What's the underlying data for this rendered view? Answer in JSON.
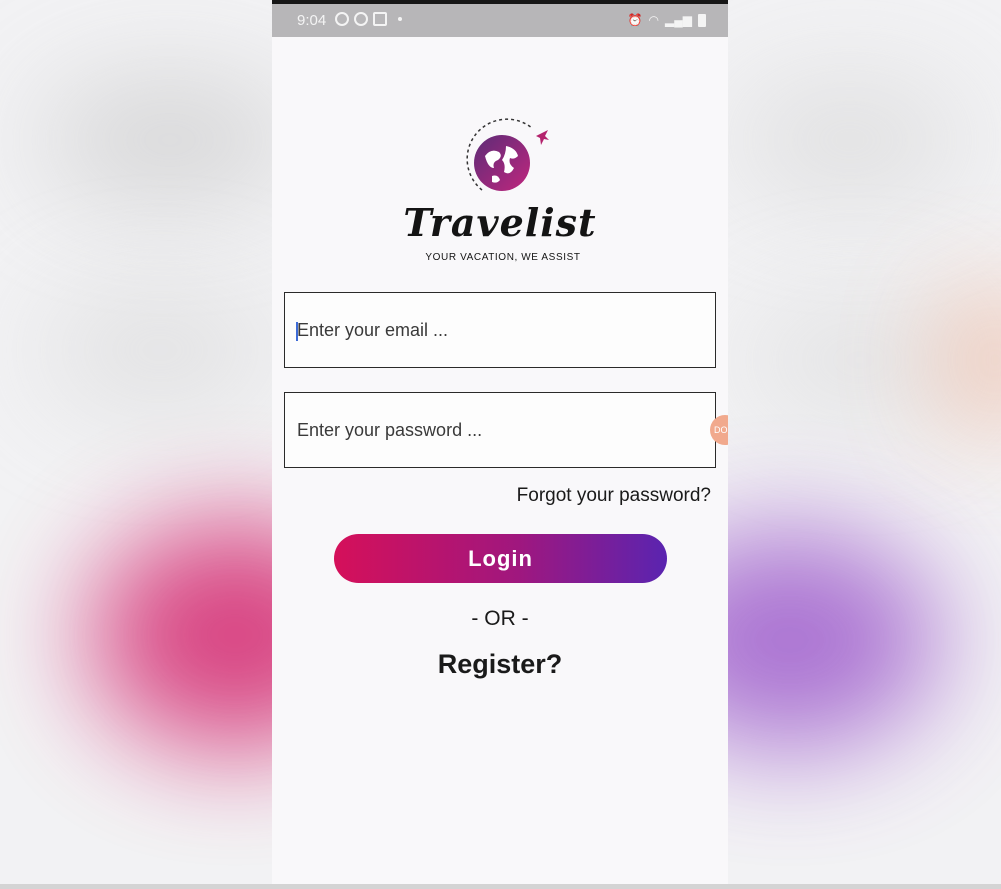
{
  "status_bar": {
    "time": "9:04",
    "left_icons": [
      "game-icon",
      "game-icon",
      "news-icon"
    ],
    "right_icons": [
      "alarm-icon",
      "wifi-icon",
      "signal-icon",
      "battery-icon"
    ]
  },
  "brand": {
    "name": "Travelist",
    "tagline": "YOUR VACATION, WE ASSIST",
    "logo_icon": "globe-airplane-icon"
  },
  "form": {
    "email_placeholder": "Enter your email ...",
    "password_placeholder": "Enter your password ..."
  },
  "links": {
    "forgot_password": "Forgot your password?",
    "or_separator": "- OR -",
    "register": "Register?"
  },
  "buttons": {
    "login": "Login"
  },
  "overlay": {
    "bubble_text": "DO"
  },
  "colors": {
    "gradient_start": "#d5105a",
    "gradient_end": "#5a24b0",
    "status_bar": "#b7b6b8"
  }
}
